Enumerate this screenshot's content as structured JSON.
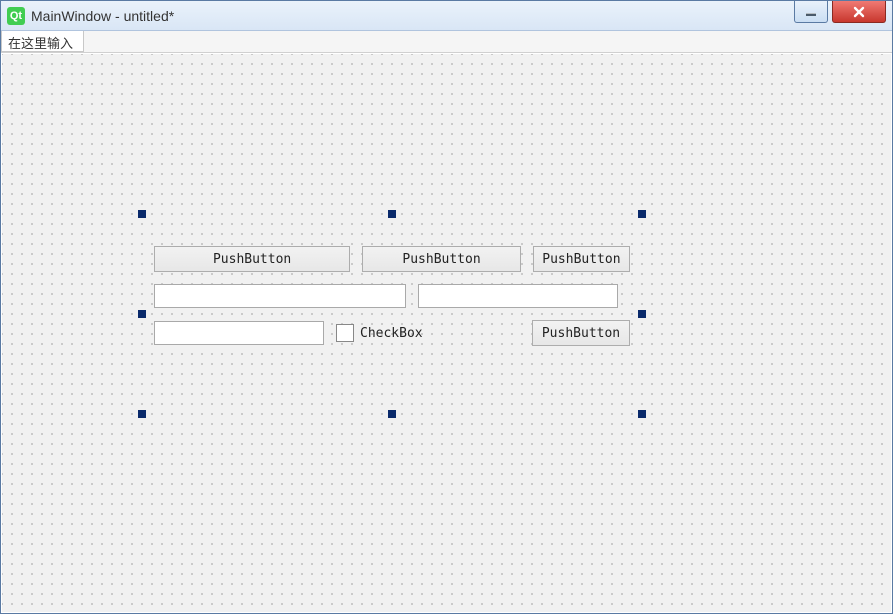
{
  "titlebar": {
    "icon_label": "Qt",
    "title": "MainWindow - untitled*"
  },
  "menubar": {
    "placeholder": "在这里输入"
  },
  "form": {
    "row1": {
      "button1": "PushButton",
      "button2": "PushButton",
      "button3": "PushButton"
    },
    "row2": {
      "lineedit1": "",
      "lineedit2": ""
    },
    "row3": {
      "lineedit3": "",
      "checkbox_label": "CheckBox",
      "checkbox_checked": false,
      "button4": "PushButton"
    }
  },
  "selection": {
    "handle_color": "#0a2a6b"
  }
}
